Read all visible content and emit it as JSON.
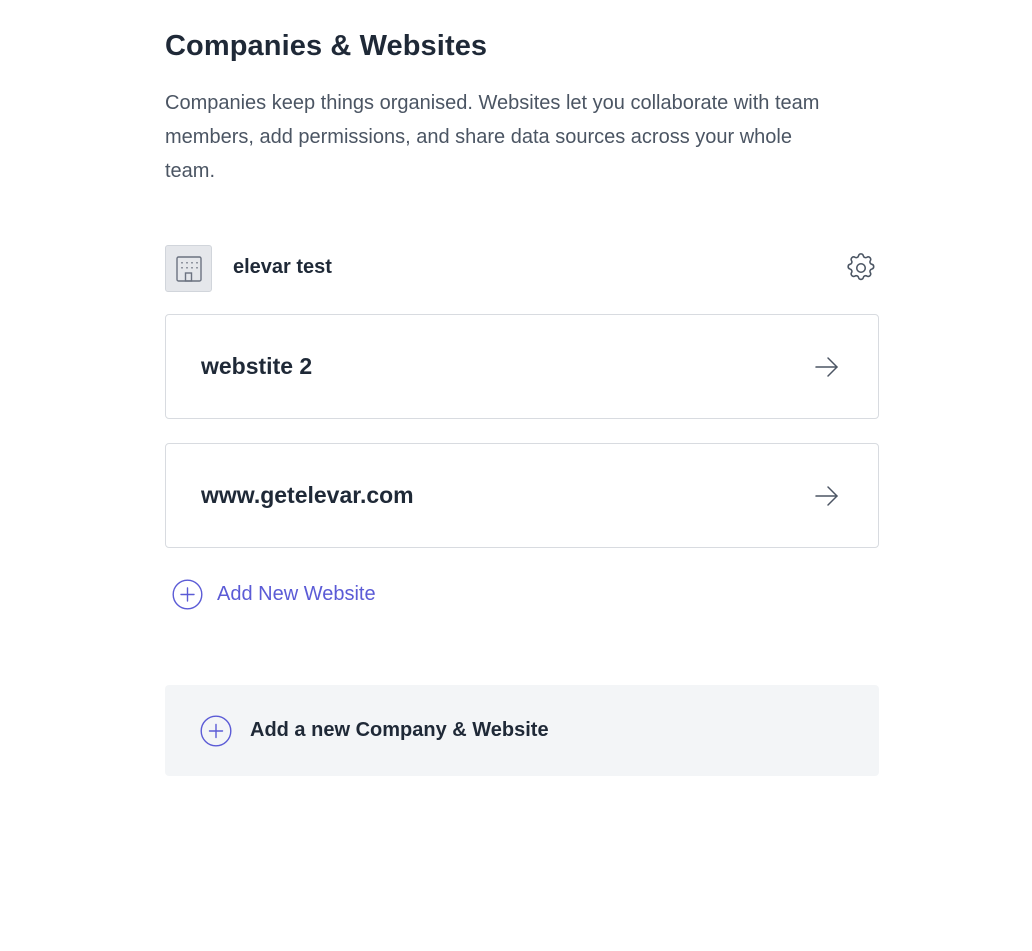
{
  "page": {
    "title": "Companies & Websites",
    "description": "Companies keep things organised. Websites let you collaborate with team members, add permissions, and share data sources across your whole team."
  },
  "company": {
    "name": "elevar test",
    "icon": "building-icon",
    "settings_icon": "gear-icon"
  },
  "websites": [
    {
      "name": "webstite 2",
      "icon": "arrow-right-icon"
    },
    {
      "name": "www.getelevar.com",
      "icon": "arrow-right-icon"
    }
  ],
  "actions": {
    "add_website_label": "Add New Website",
    "add_company_label": "Add a new Company & Website"
  },
  "colors": {
    "accent": "#5b5bd6",
    "text": "#1f2937",
    "muted_text": "#4b5563",
    "card_border": "#d8dbe0",
    "panel_bg": "#f3f5f7"
  }
}
